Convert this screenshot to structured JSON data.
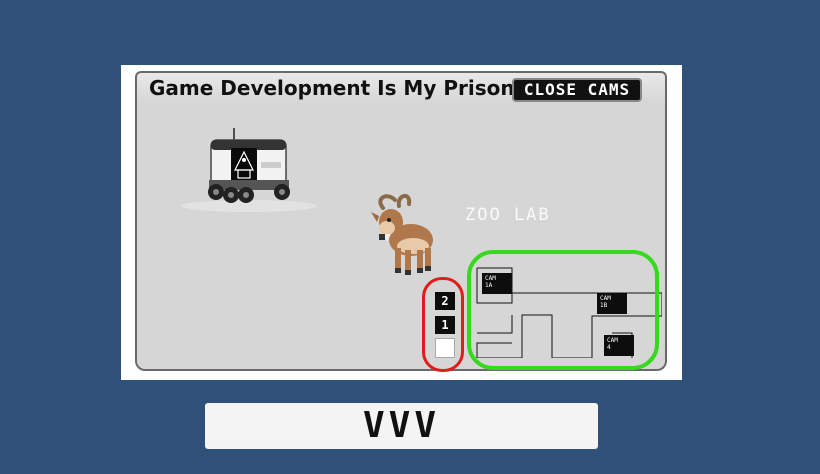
{
  "monitor": {
    "title": "Game Development Is My Prison",
    "close_cams_label": "CLOSE CAMS"
  },
  "camera_view": {
    "room_label": "ZOO LAB",
    "characters": [
      "delivery-robot",
      "goat"
    ]
  },
  "floors": {
    "buttons": [
      {
        "label": "2"
      },
      {
        "label": "1"
      },
      {
        "label": ""
      }
    ]
  },
  "map": {
    "cams": [
      {
        "line1": "CAM",
        "line2": "1A"
      },
      {
        "line1": "CAM",
        "line2": "1B"
      },
      {
        "line1": "CAM",
        "line2": "4"
      }
    ]
  },
  "annotations": {
    "red_circle_color": "#e21b1b",
    "green_circle_color": "#36d91e"
  },
  "code_panel": {
    "text": "VVV"
  },
  "colors": {
    "background": "#2f5079",
    "monitor_screen": "#d6d6d6"
  }
}
